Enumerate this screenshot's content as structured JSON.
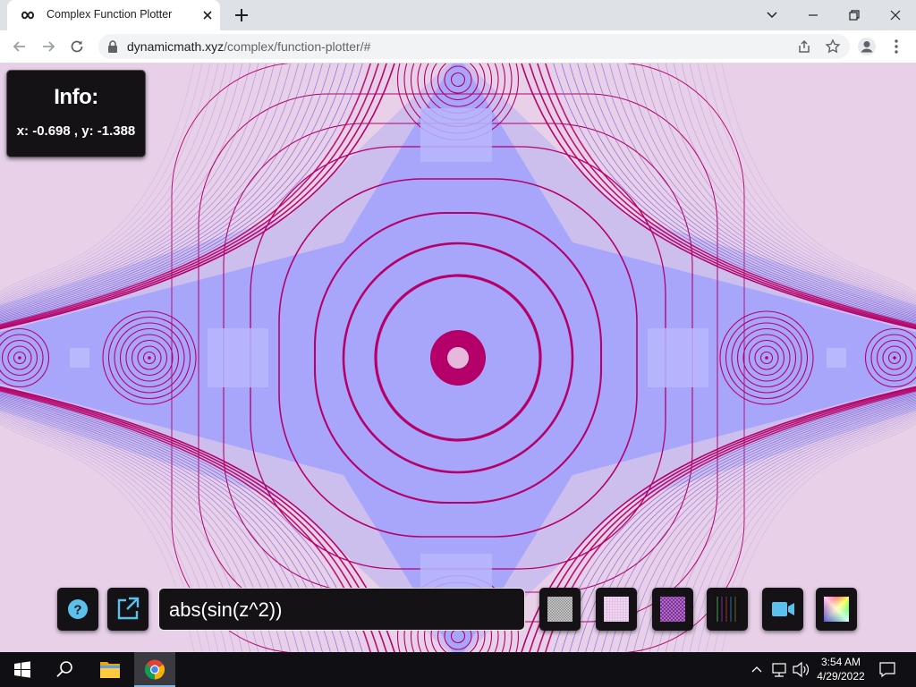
{
  "browser": {
    "tab_title": "Complex Function Plotter",
    "url_host": "dynamicmath.xyz",
    "url_path": "/complex/function-plotter/#"
  },
  "icons": {
    "favicon": "infinity-icon",
    "back": "back-arrow-icon",
    "forward": "forward-arrow-icon",
    "reload": "reload-icon",
    "share": "share-icon",
    "bookmark": "star-icon",
    "profile": "profile-icon",
    "menu": "kebab-menu-icon"
  },
  "info_panel": {
    "title": "Info:",
    "coords": "x: -0.698 , y: -1.388"
  },
  "expression": {
    "value": "abs(sin(z^2))"
  },
  "controls": {
    "help": "question-circle-icon",
    "open": "external-link-icon",
    "themes": [
      "gray-checker",
      "pink-grid",
      "purple-mesh",
      "dark-stripes"
    ],
    "record": "video-camera-icon",
    "colors": "color-wheel-icon"
  },
  "colors": {
    "background": "#e7d0e8",
    "field": "#a9a7fb",
    "contour": "#b5006a",
    "panel": "#151216"
  },
  "taskbar": {
    "time": "3:54 AM",
    "date": "4/29/2022"
  }
}
